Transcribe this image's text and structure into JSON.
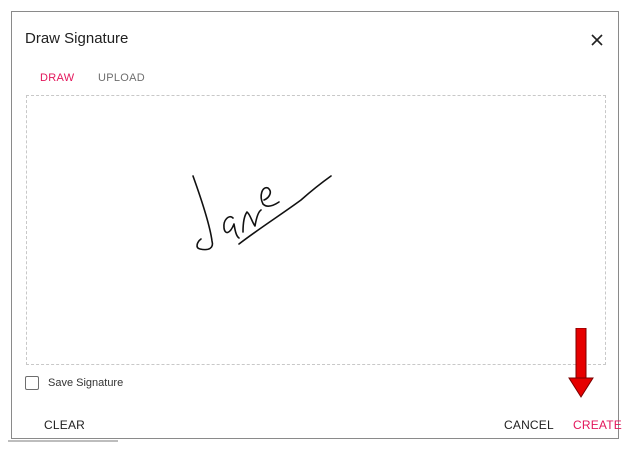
{
  "dialog": {
    "title": "Draw Signature",
    "close_icon": "close-icon"
  },
  "tabs": [
    {
      "label": "DRAW",
      "active": true
    },
    {
      "label": "UPLOAD",
      "active": false
    }
  ],
  "canvas": {
    "signature_text": "Jane"
  },
  "save_signature": {
    "label": "Save Signature",
    "checked": false
  },
  "footer": {
    "clear_label": "CLEAR",
    "cancel_label": "CANCEL",
    "create_label": "CREATE"
  },
  "colors": {
    "accent": "#e3165b",
    "arrow": "#e60000",
    "text": "#212121"
  }
}
